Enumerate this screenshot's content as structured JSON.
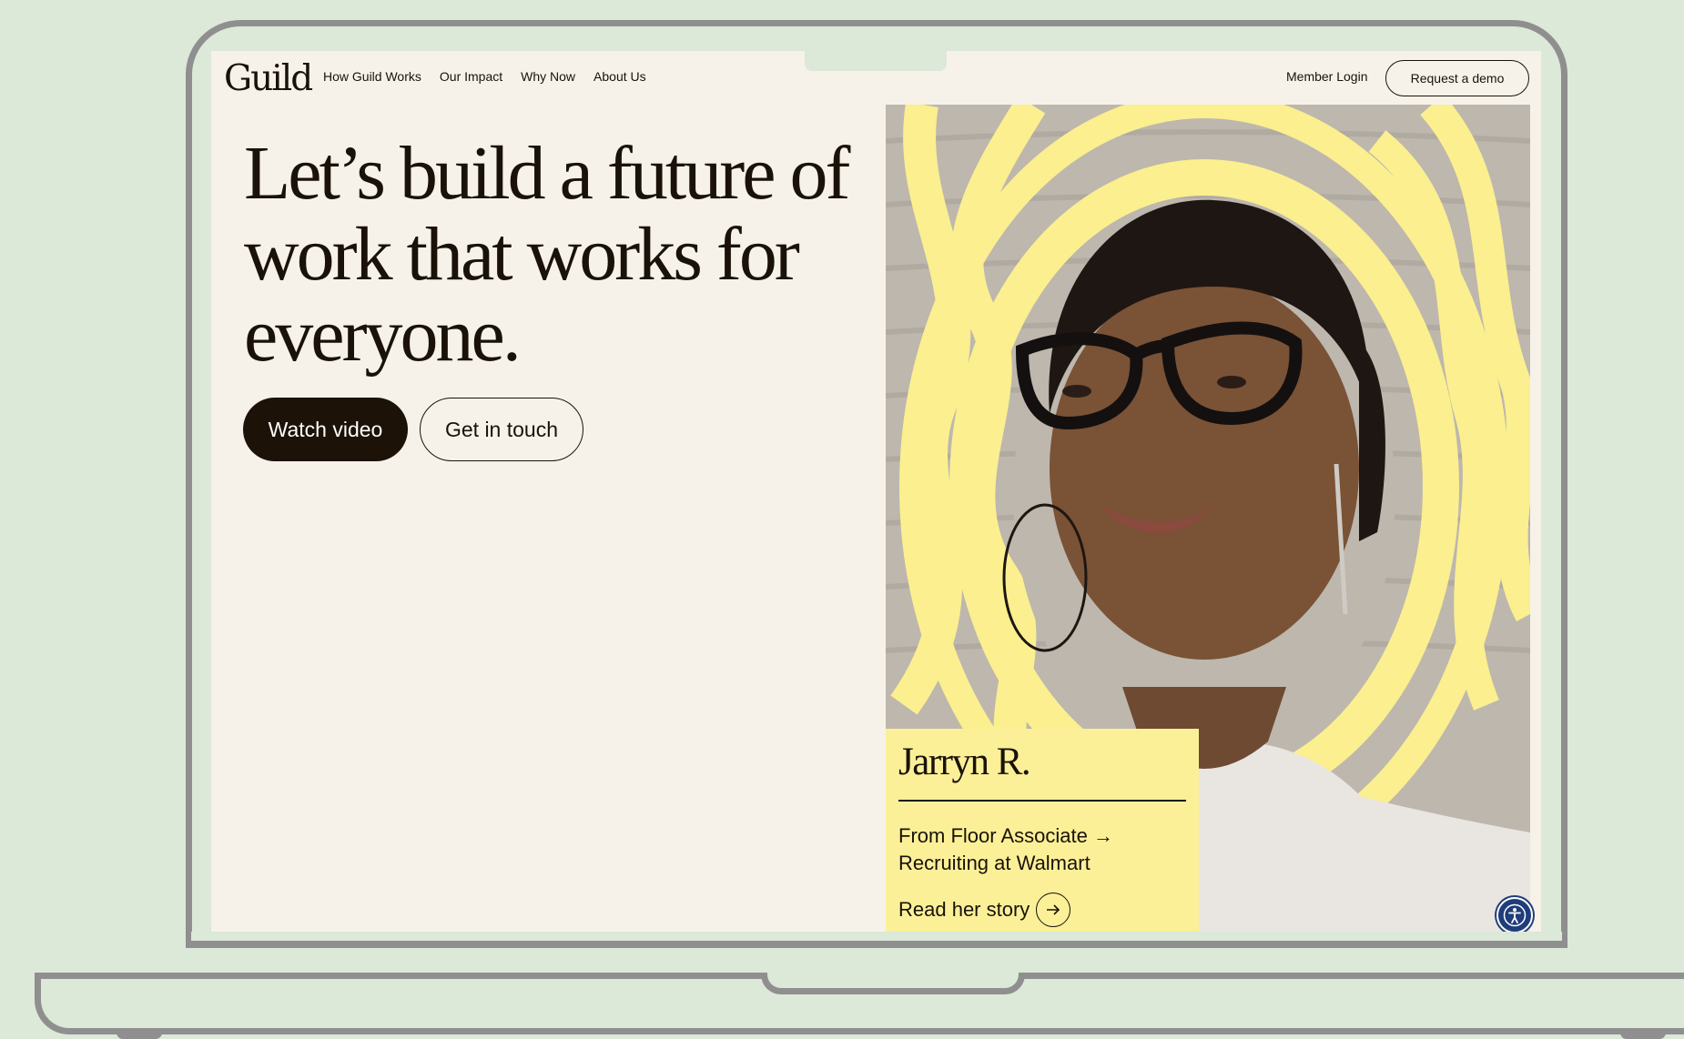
{
  "nav": {
    "logo": "Guild",
    "links": [
      "How Guild Works",
      "Our Impact",
      "Why Now",
      "About Us"
    ],
    "member_login": "Member Login",
    "request_demo": "Request a demo"
  },
  "hero": {
    "headline": "Let’s build a future of work that works for everyone.",
    "watch_video": "Watch video",
    "get_in_touch": "Get in touch"
  },
  "story": {
    "name": "Jarryn R.",
    "role": "From Floor Associate → Recruiting at Walmart",
    "read_link": "Read her story"
  },
  "icons": {
    "story_arrow": "arrow-right-icon",
    "accessibility": "accessibility-icon"
  },
  "colors": {
    "page_background": "#dce8d8",
    "screen_background": "#f6f2ea",
    "primary_dark": "#1c1208",
    "story_card": "#fbf098",
    "swirl_yellow": "#fbef8f",
    "accessibility_blue": "#1f3d7a"
  }
}
